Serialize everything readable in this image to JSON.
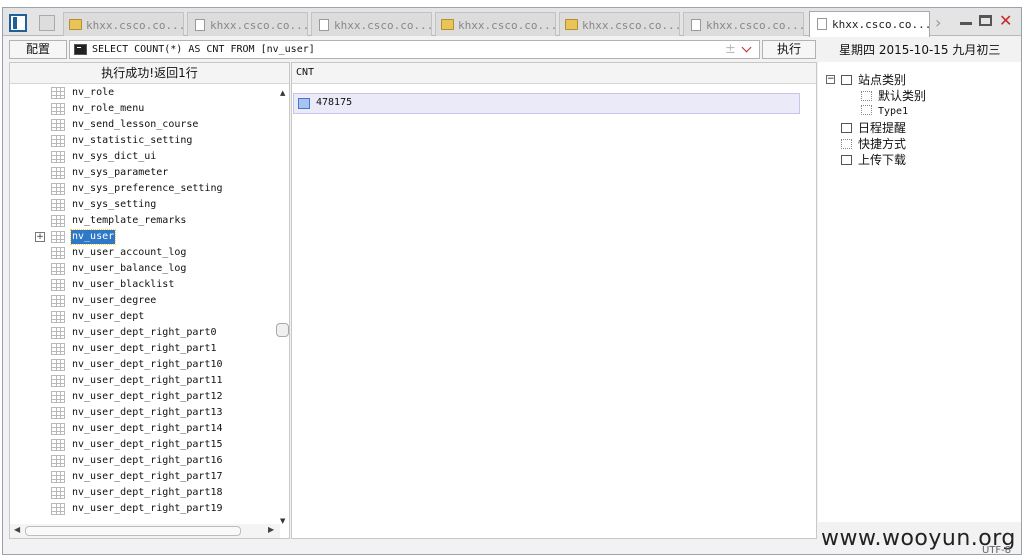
{
  "tabs": [
    {
      "label": "khxx.csco.co...",
      "icon": "folder-icon",
      "active": false
    },
    {
      "label": "khxx.csco.co...",
      "icon": "page-icon",
      "active": false
    },
    {
      "label": "khxx.csco.co...",
      "icon": "page-icon",
      "active": false
    },
    {
      "label": "khxx.csco.co...",
      "icon": "folder-icon",
      "active": false
    },
    {
      "label": "khxx.csco.co...",
      "icon": "folder-icon",
      "active": false
    },
    {
      "label": "khxx.csco.co...",
      "icon": "page-icon",
      "active": false
    },
    {
      "label": "khxx.csco.co...",
      "icon": "page-icon",
      "active": true
    }
  ],
  "toolbar": {
    "config_label": "配置",
    "sql_query": "SELECT COUNT(*) AS CNT FROM [nv_user]",
    "run_label": "执行",
    "date_text": "星期四 2015-10-15 九月初三"
  },
  "left_panel": {
    "status": "执行成功!返回1行",
    "tables": [
      "nv_role",
      "nv_role_menu",
      "nv_send_lesson_course",
      "nv_statistic_setting",
      "nv_sys_dict_ui",
      "nv_sys_parameter",
      "nv_sys_preference_setting",
      "nv_sys_setting",
      "nv_template_remarks",
      "nv_user",
      "nv_user_account_log",
      "nv_user_balance_log",
      "nv_user_blacklist",
      "nv_user_degree",
      "nv_user_dept",
      "nv_user_dept_right_part0",
      "nv_user_dept_right_part1",
      "nv_user_dept_right_part10",
      "nv_user_dept_right_part11",
      "nv_user_dept_right_part12",
      "nv_user_dept_right_part13",
      "nv_user_dept_right_part14",
      "nv_user_dept_right_part15",
      "nv_user_dept_right_part16",
      "nv_user_dept_right_part17",
      "nv_user_dept_right_part18",
      "nv_user_dept_right_part19"
    ],
    "selected_table": "nv_user"
  },
  "result": {
    "column": "CNT",
    "value": "478175"
  },
  "tree": {
    "root": "站点类别",
    "children": [
      "默认类别",
      "Type1"
    ],
    "items": [
      "日程提醒",
      "快捷方式",
      "上传下载"
    ]
  },
  "footer": {
    "watermark": "www.wooyun.org",
    "encoding": "UTF-8"
  },
  "colors": {
    "selection": "#2f78c8",
    "close": "#c62828",
    "accent": "#1f5f9a"
  }
}
